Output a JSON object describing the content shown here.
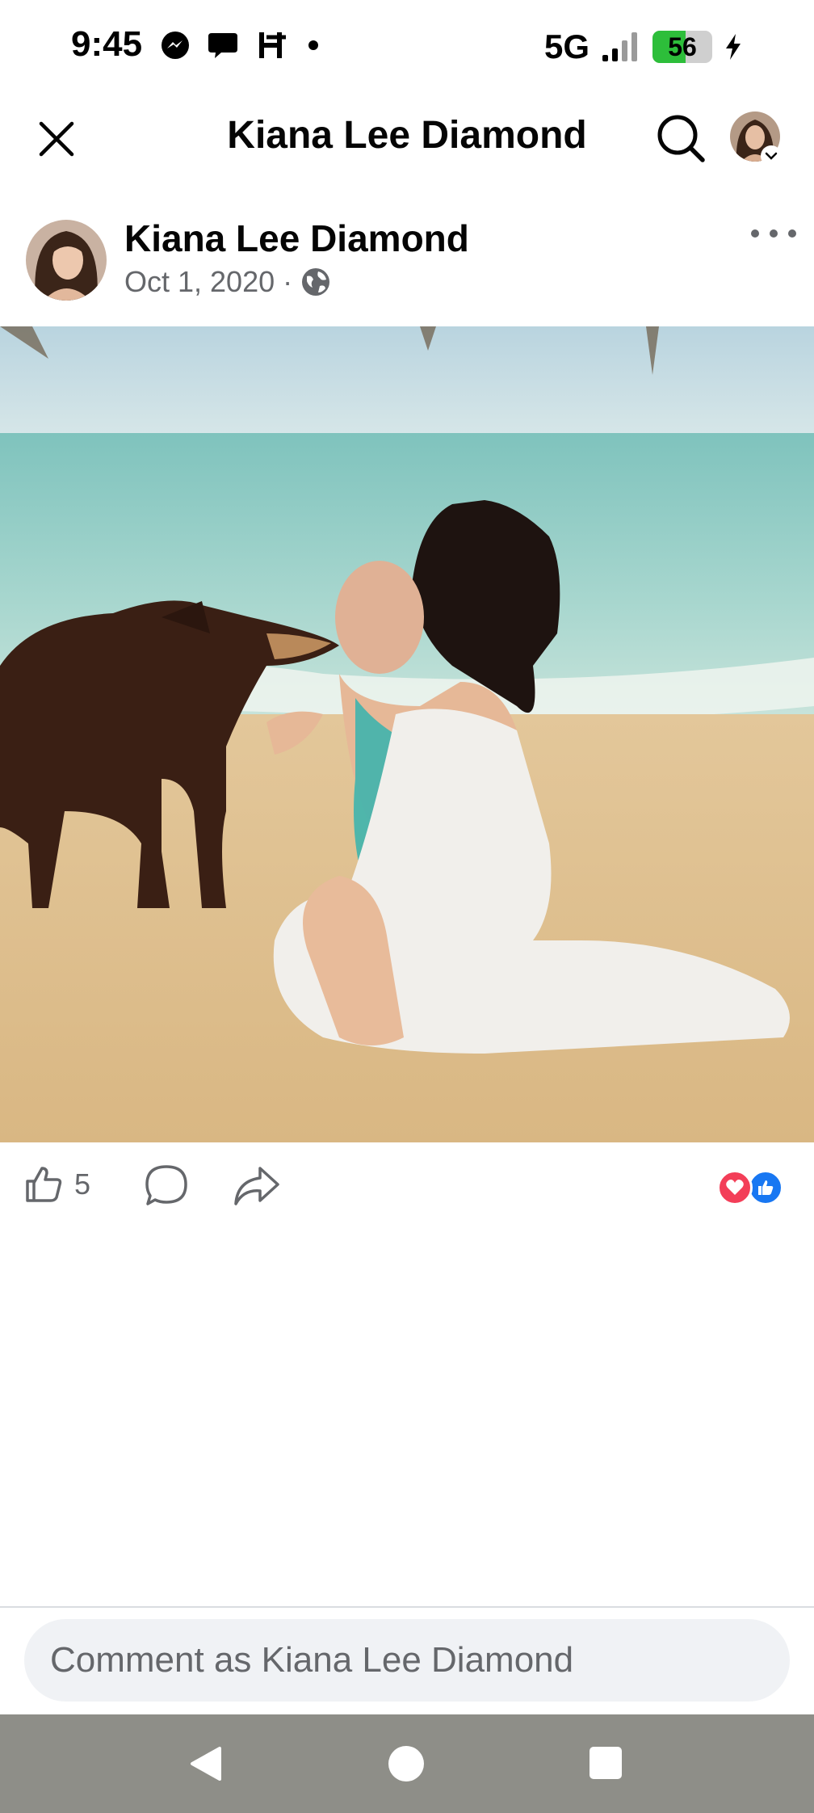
{
  "status_bar": {
    "time": "9:45",
    "network": "5G",
    "battery": "56",
    "battery_level": 0.56,
    "icons": [
      "messenger-icon",
      "chat-bubble-icon",
      "h-app-icon",
      "notification-dot-icon",
      "signal-icon",
      "battery-icon",
      "charging-bolt-icon"
    ]
  },
  "header": {
    "title": "Kiana Lee Diamond",
    "icons": [
      "close-icon",
      "search-icon",
      "avatar",
      "chevron-down-icon"
    ]
  },
  "post": {
    "author": "Kiana Lee Diamond",
    "date": "Oct 1, 2020",
    "separator": "·",
    "audience_icon": "globe-icon",
    "more_icon": "more-options-icon"
  },
  "actions": {
    "like_count": "5",
    "icons": [
      "thumbs-up-icon",
      "comment-icon",
      "share-icon"
    ],
    "reactions": [
      "love-reaction-icon",
      "like-reaction-icon"
    ]
  },
  "comment": {
    "placeholder": "Comment as Kiana Lee Diamond"
  },
  "nav_bar": {
    "icons": [
      "back-icon",
      "home-icon",
      "recents-icon"
    ]
  },
  "colors": {
    "primary_text": "#050505",
    "secondary_text": "#65676b",
    "like_blue": "#1877f2",
    "love_red": "#f33e58",
    "battery_green": "#2dbe3a",
    "nav_bar": "#8e8e88",
    "comment_bg": "#f0f2f5"
  }
}
